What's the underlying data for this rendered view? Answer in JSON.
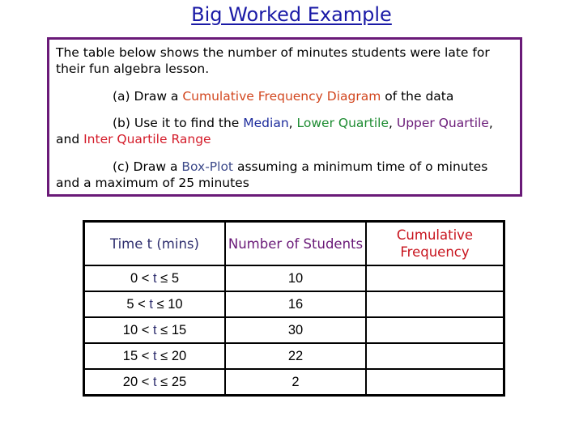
{
  "title": "Big Worked Example",
  "question": {
    "intro": "The table below shows the number of minutes students were late for their fun algebra lesson.",
    "part_a": {
      "prefix": "(a) Draw a ",
      "term": "Cumulative Frequency Diagram",
      "suffix": " of the data"
    },
    "part_b": {
      "prefix": "(b) Use it to find the ",
      "median": "Median",
      "sep1": ", ",
      "lower_quartile": "Lower Quartile",
      "sep2": ", ",
      "upper_quartile": "Upper Quartile",
      "sep3": ", and ",
      "iqr": "Inter Quartile Range"
    },
    "part_c": {
      "prefix": "(c) Draw a ",
      "term": "Box-Plot",
      "suffix": " assuming a minimum time of o minutes and a maximum of 25 minutes"
    }
  },
  "table": {
    "headers": [
      "Time t (mins)",
      "Number of Students",
      "Cumulative Frequency"
    ],
    "rows": [
      {
        "lower": "0",
        "upper": "5",
        "students": "10",
        "cumulative": ""
      },
      {
        "lower": "5",
        "upper": "10",
        "students": "16",
        "cumulative": ""
      },
      {
        "lower": "10",
        "upper": "15",
        "students": "30",
        "cumulative": ""
      },
      {
        "lower": "15",
        "upper": "20",
        "students": "22",
        "cumulative": ""
      },
      {
        "lower": "20",
        "upper": "25",
        "students": "2",
        "cumulative": ""
      }
    ],
    "variable": "t",
    "lt_symbol": "<",
    "le_symbol": "≤"
  },
  "colors": {
    "title": "#1a1aa6",
    "box_border": "#6a1a78",
    "cumulative_frequency_diagram": "#d2461e",
    "median": "#1c2b9c",
    "lower_quartile": "#1e8c32",
    "upper_quartile": "#6a1a78",
    "inter_quartile_range": "#d41c2a",
    "box_plot": "#3d4a8a"
  }
}
